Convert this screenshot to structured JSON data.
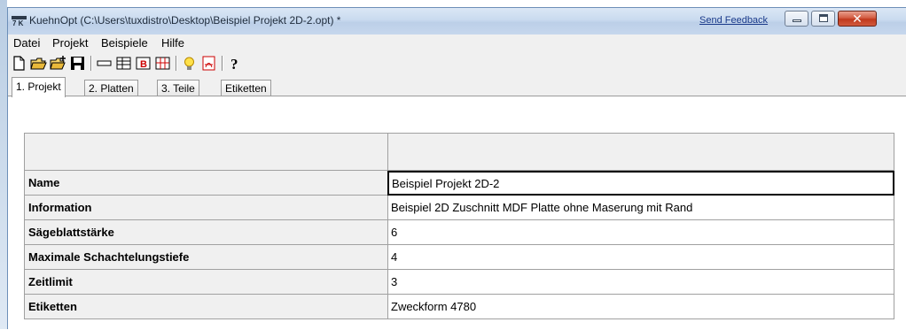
{
  "window": {
    "title": "KuehnOpt (C:\\Users\\tuxdistro\\Desktop\\Beispiel Projekt 2D-2.opt) *",
    "app_icon_text": "7 K",
    "feedback_link": "Send Feedback",
    "close_glyph": "✕"
  },
  "menu": [
    "Datei",
    "Projekt",
    "Beispiele",
    "Hilfe"
  ],
  "toolbar": {
    "icons": [
      "new-file-icon",
      "open-folder-icon",
      "open-folder-add-icon",
      "save-icon",
      "line-icon",
      "table-icon",
      "b-report-icon",
      "grid-icon",
      "lightbulb-icon",
      "pdf-icon",
      "help-icon"
    ],
    "help_glyph": "?"
  },
  "tabs": [
    "1. Projekt",
    "2. Platten",
    "3. Teile",
    "Etiketten"
  ],
  "active_tab": "1. Projekt",
  "properties": [
    {
      "key": "Name",
      "value": "Beispiel Projekt 2D-2"
    },
    {
      "key": "Information",
      "value": "Beispiel 2D Zuschnitt MDF Platte ohne Maserung mit Rand"
    },
    {
      "key": "Sägeblattstärke",
      "value": "6"
    },
    {
      "key": "Maximale Schachtelungstiefe",
      "value": "4"
    },
    {
      "key": "Zeitlimit",
      "value": "3"
    },
    {
      "key": "Etiketten",
      "value": "Zweckform 4780"
    }
  ],
  "colors": {
    "titlebar": "#c9daef",
    "close_button": "#c0391d",
    "grid_line": "#a0a0a0"
  }
}
